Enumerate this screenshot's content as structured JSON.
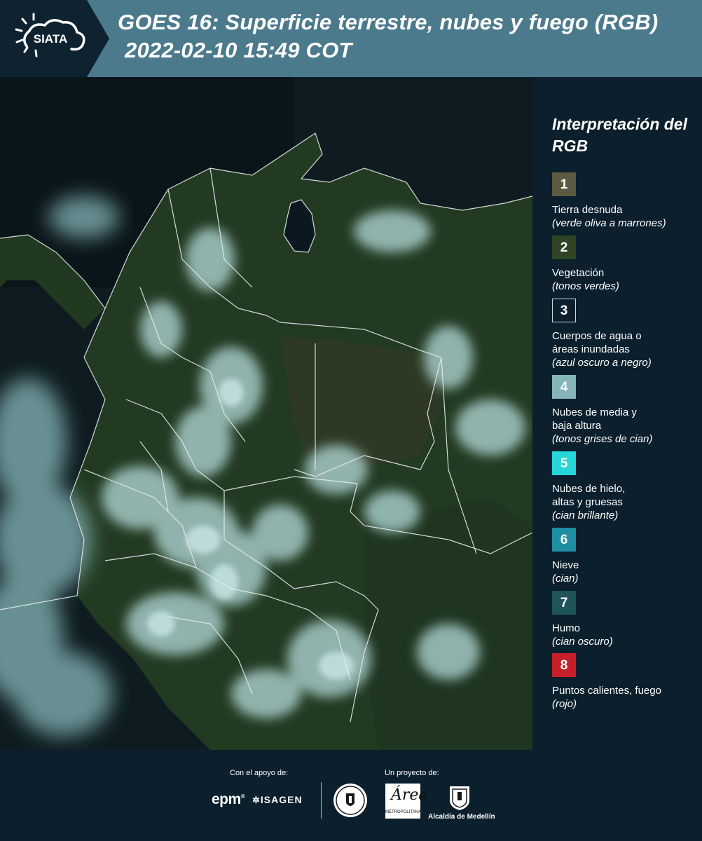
{
  "header": {
    "logo_text": "SIATA",
    "title_line1": "GOES 16: Superficie terrestre, nubes y fuego (RGB)",
    "title_line2": "2022-02-10 15:49 COT"
  },
  "map": {
    "icon": "satellite-rgb-composite",
    "colors": {
      "background_ocean": "#0d1a1f",
      "vegetation": "#243e26",
      "cloud": "#a9d3d4",
      "boundary": "#e8ecec"
    }
  },
  "legend": {
    "title": "Interpretación del RGB",
    "items": [
      {
        "number": "1",
        "name": "Tierra desnuda",
        "desc": "(verde oliva a marrones)",
        "color": "#5c5b42",
        "border": "#5c5b42"
      },
      {
        "number": "2",
        "name": "Vegetación",
        "desc": "(tonos verdes)",
        "color": "#2e4423",
        "border": "#2e4423"
      },
      {
        "number": "3",
        "name": "Cuerpos de agua o áreas inundadas",
        "desc": "(azul oscuro a negro)",
        "color": "#0b1f2c",
        "border": "#cfd8dc"
      },
      {
        "number": "4",
        "name": "Nubes de media y baja altura",
        "desc": "(tonos grises de cian)",
        "color": "#86b5b8",
        "border": "#86b5b8"
      },
      {
        "number": "5",
        "name": "Nubes de hielo, altas y gruesas",
        "desc": "(cian brillante)",
        "color": "#26d5d8",
        "border": "#26d5d8"
      },
      {
        "number": "6",
        "name": "Nieve",
        "desc": "(cian)",
        "color": "#1e8ea3",
        "border": "#1e8ea3"
      },
      {
        "number": "7",
        "name": "Humo",
        "desc": "(cian oscuro)",
        "color": "#1f5559",
        "border": "#1f5559"
      },
      {
        "number": "8",
        "name": "Puntos calientes, fuego",
        "desc": "(rojo)",
        "color": "#c8202a",
        "border": "#c8202a"
      }
    ]
  },
  "footer": {
    "support_label": "Con el apoyo de:",
    "project_label": "Un proyecto de:",
    "sponsor_epm": "epm",
    "sponsor_isagen": "ISAGEN",
    "amva_mark": "Área",
    "amva_name": "METROPOLITANA",
    "medellin_name": "Alcaldía de Medellín"
  }
}
